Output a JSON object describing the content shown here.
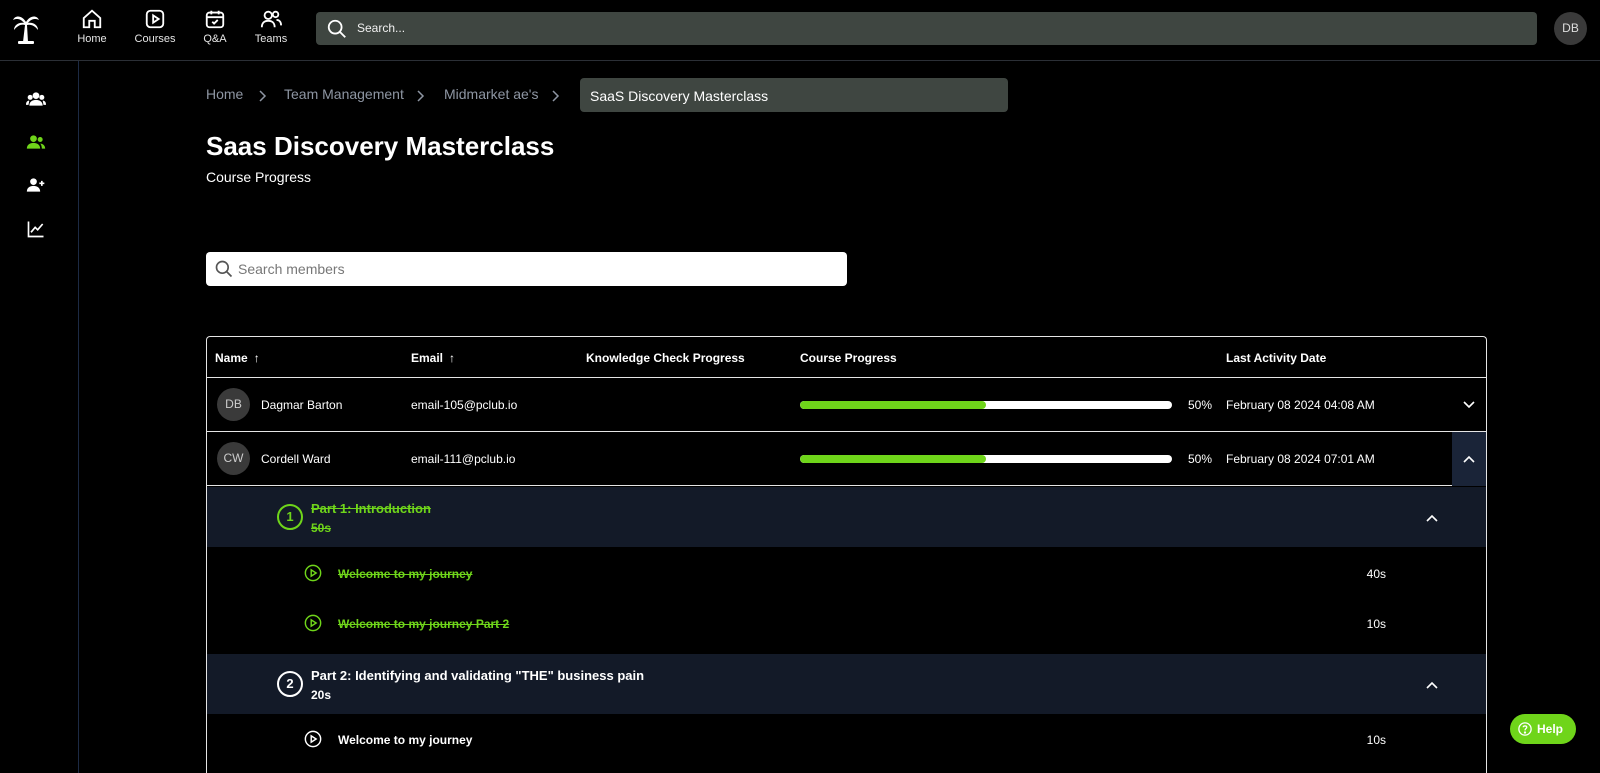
{
  "nav": {
    "items": [
      {
        "label": "Home",
        "icon": "home-icon"
      },
      {
        "label": "Courses",
        "icon": "play-square-icon"
      },
      {
        "label": "Q&A",
        "icon": "calendar-check-icon"
      },
      {
        "label": "Teams",
        "icon": "users-icon"
      }
    ],
    "search_placeholder": "Search...",
    "user_initials": "DB"
  },
  "sidebar": {
    "icons": [
      "team-icon",
      "members-icon",
      "add-member-icon",
      "chart-icon"
    ],
    "active_color": "#6fd51a"
  },
  "breadcrumb": {
    "items": [
      "Home",
      "Team Management",
      "Midmarket ae's"
    ],
    "current": "SaaS Discovery Masterclass"
  },
  "page": {
    "title": "Saas Discovery Masterclass",
    "subtitle": "Course Progress",
    "member_search_placeholder": "Search members"
  },
  "table": {
    "headers": {
      "name": "Name",
      "email": "Email",
      "knowledge": "Knowledge Check Progress",
      "progress": "Course Progress",
      "last_activity": "Last Activity Date"
    },
    "sort_arrow": "↑",
    "rows": [
      {
        "initials": "DB",
        "name": "Dagmar Barton",
        "email": "email-105@pclub.io",
        "progress": 50,
        "progress_label": "50%",
        "last_activity": "February 08 2024 04:08 AM",
        "expanded": false
      },
      {
        "initials": "CW",
        "name": "Cordell Ward",
        "email": "email-111@pclub.io",
        "progress": 50,
        "progress_label": "50%",
        "last_activity": "February 08 2024 07:01 AM",
        "expanded": true
      }
    ],
    "sections": [
      {
        "number": "1",
        "title": "Part 1: Introduction",
        "duration": "50s",
        "completed": true,
        "lessons": [
          {
            "title": "Welcome to my journey",
            "duration": "40s",
            "completed": true
          },
          {
            "title": "Welcome to my journey Part 2",
            "duration": "10s",
            "completed": true
          }
        ]
      },
      {
        "number": "2",
        "title": "Part 2: Identifying and validating \"THE\" business pain",
        "duration": "20s",
        "completed": false,
        "lessons": [
          {
            "title": "Welcome to my journey",
            "duration": "10s",
            "completed": false
          }
        ]
      }
    ]
  },
  "help": {
    "label": "Help"
  },
  "colors": {
    "accent": "#6fd51a",
    "search_bg": "#3f4641",
    "section_bg": "#131a28"
  }
}
